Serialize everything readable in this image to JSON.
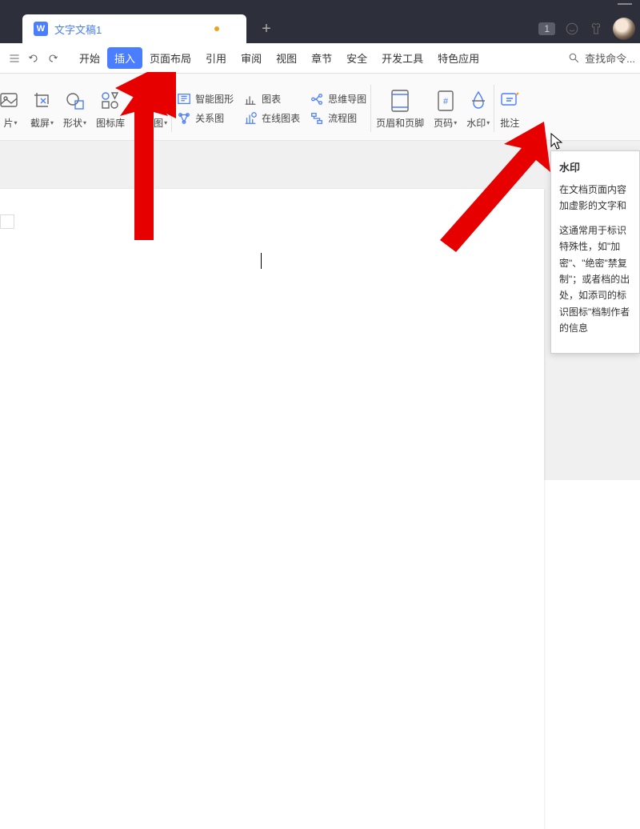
{
  "titlebar": {
    "tab_title": "文字文稿1",
    "badge": "1"
  },
  "menubar": {
    "items": [
      "开始",
      "插入",
      "页面布局",
      "引用",
      "审阅",
      "视图",
      "章节",
      "安全",
      "开发工具",
      "特色应用"
    ],
    "active_index": 1,
    "search_placeholder": "查找命令..."
  },
  "ribbon": {
    "groups_left": [
      {
        "label": "片",
        "has_caret": true
      },
      {
        "label": "截屏",
        "has_caret": true
      },
      {
        "label": "形状",
        "has_caret": true
      },
      {
        "label": "图标库",
        "has_caret": false
      },
      {
        "label": "功能图",
        "has_caret": true
      }
    ],
    "stack1": [
      {
        "label": "智能图形"
      },
      {
        "label": "关系图"
      }
    ],
    "stack2": [
      {
        "label": "图表"
      },
      {
        "label": "在线图表"
      }
    ],
    "stack3": [
      {
        "label": "思维导图"
      },
      {
        "label": "流程图"
      }
    ],
    "groups_right": [
      {
        "label": "页眉和页脚"
      },
      {
        "label": "页码",
        "has_caret": true
      },
      {
        "label": "水印",
        "has_caret": true
      },
      {
        "label": "批注"
      }
    ]
  },
  "tooltip": {
    "title": "水印",
    "line1": "在文档页面内容加虚影的文字和",
    "line2": "这通常用于标识特殊性，如\"加密\"、\"绝密\"禁复制\"；或者档的出处，如添司的标识图标\"档制作者的信息"
  }
}
